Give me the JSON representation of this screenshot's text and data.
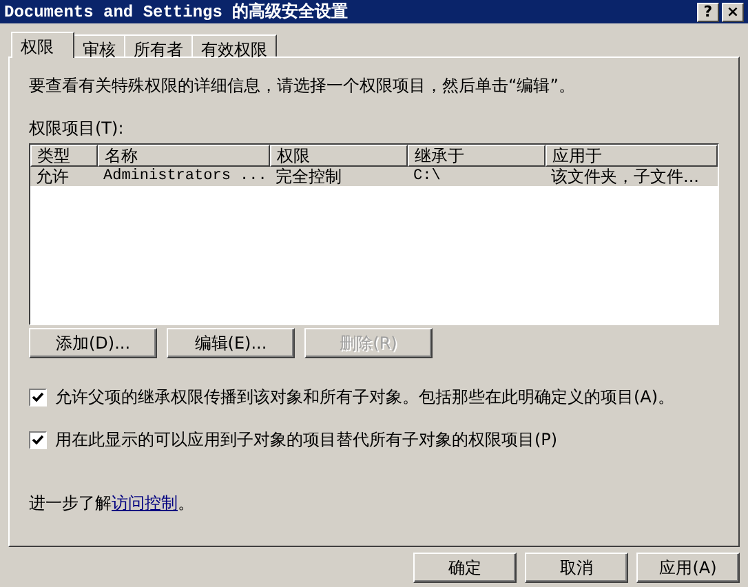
{
  "window": {
    "title": "Documents and Settings 的高级安全设置",
    "help_button": "?",
    "close_button": "×"
  },
  "tabs": [
    {
      "label": "权限",
      "selected": true
    },
    {
      "label": "审核",
      "selected": false
    },
    {
      "label": "所有者",
      "selected": false
    },
    {
      "label": "有效权限",
      "selected": false
    }
  ],
  "instruction": "要查看有关特殊权限的详细信息，请选择一个权限项目，然后单击“编辑”。",
  "table": {
    "label": "权限项目(T):",
    "columns": [
      "类型",
      "名称",
      "权限",
      "继承于",
      "应用于"
    ],
    "rows": [
      {
        "cells": [
          "允许",
          "Administrators ...",
          "完全控制",
          "C:\\",
          "该文件夹，子文件..."
        ],
        "selected": true
      }
    ]
  },
  "actions": [
    {
      "label": "添加(D)...",
      "disabled": false
    },
    {
      "label": "编辑(E)...",
      "disabled": false
    },
    {
      "label": "删除(R)",
      "disabled": true
    }
  ],
  "options": [
    {
      "label": "允许父项的继承权限传播到该对象和所有子对象。包括那些在此明确定义的项目(A)。",
      "checked": true
    },
    {
      "label": "用在此显示的可以应用到子对象的项目替代所有子对象的权限项目(P)",
      "checked": true
    }
  ],
  "learn_more": {
    "text": "进一步了解",
    "link": "访问控制",
    "end": "。"
  },
  "buttons": [
    "确定",
    "取消",
    "应用(A)"
  ]
}
